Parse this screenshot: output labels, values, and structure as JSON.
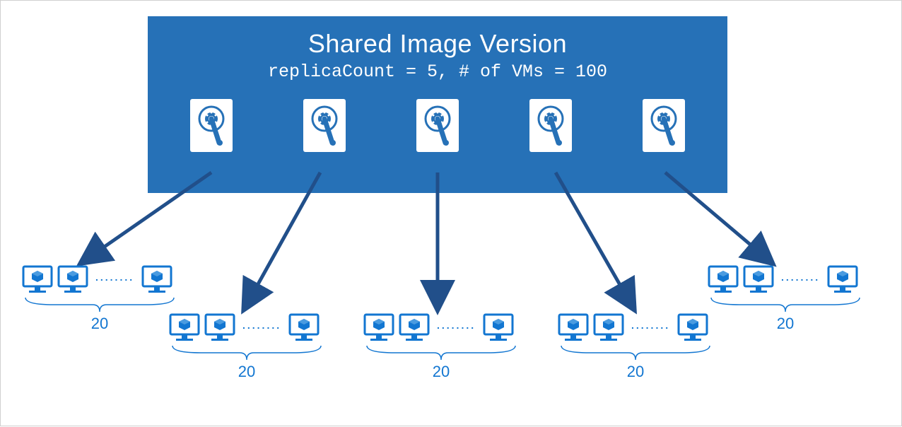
{
  "header": {
    "title": "Shared Image Version",
    "subtitle": "replicaCount = 5, # of VMs = 100"
  },
  "replica_count": 5,
  "vm_groups": [
    {
      "count_label": "20",
      "ellipsis": "........"
    },
    {
      "count_label": "20",
      "ellipsis": "........"
    },
    {
      "count_label": "20",
      "ellipsis": "........"
    },
    {
      "count_label": "20",
      "ellipsis": "........"
    },
    {
      "count_label": "20",
      "ellipsis": "........"
    }
  ],
  "colors": {
    "box_bg": "#2671b7",
    "accent": "#1276d1",
    "arrow": "#214f8a"
  }
}
